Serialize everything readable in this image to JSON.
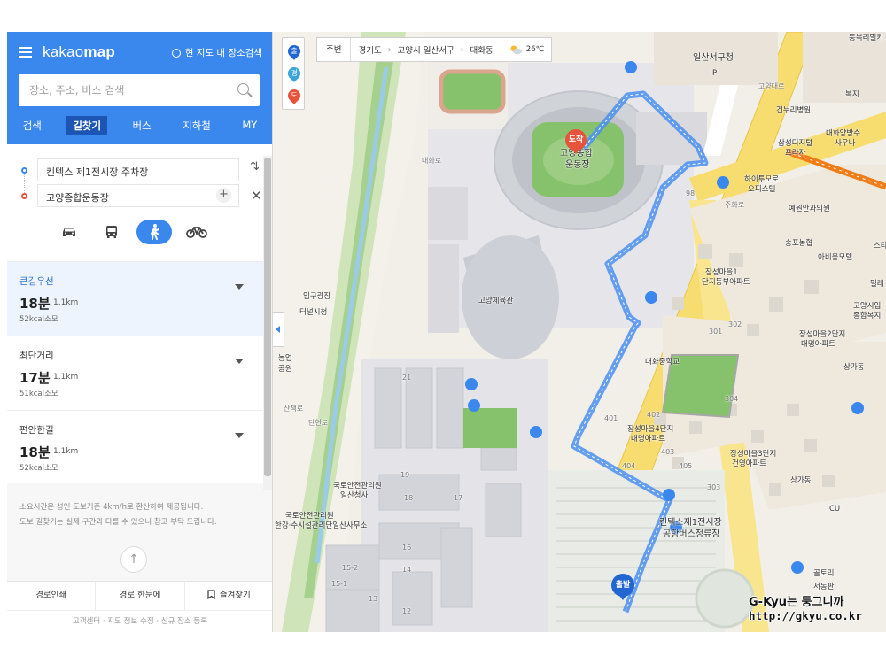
{
  "panel": {
    "logo_light": "kakao",
    "logo_bold": "map",
    "map_search_label": "현 지도 내 장소검색",
    "search_placeholder": "장소, 주소, 버스 검색",
    "tabs": [
      "검색",
      "길찾기",
      "버스",
      "지하철",
      "MY"
    ],
    "active_tab": "길찾기",
    "origin": "킨텍스 제1전시장 주차장",
    "destination": "고양종합운동장",
    "modes": [
      "car-icon",
      "bus-icon",
      "walk-icon",
      "bike-icon"
    ],
    "active_mode": "walk-icon",
    "routes": [
      {
        "name": "큰길우선",
        "time": "18분",
        "distance": "1.1km",
        "calories": "52kcal소모"
      },
      {
        "name": "최단거리",
        "time": "17분",
        "distance": "1.1km",
        "calories": "51kcal소모"
      },
      {
        "name": "편안한길",
        "time": "18분",
        "distance": "1.1km",
        "calories": "52kcal소모"
      }
    ],
    "note1": "소요시간은 성인 도보기준 4km/h로 환산하여 제공됩니다.",
    "note2": "도보 길찾기는 실제 구간과 다를 수 있으니 참고 부탁 드립니다.",
    "actions": [
      "경로인쇄",
      "경로 한눈에",
      "즐겨찾기"
    ],
    "footer": [
      "고객센터",
      "지도 정보 수정",
      "신규 장소 등록"
    ]
  },
  "map": {
    "nearby_button": "주변",
    "marker_labels": [
      "출",
      "경",
      "도"
    ],
    "breadcrumbs": [
      "경기도",
      "고양시 일산서구",
      "대화동"
    ],
    "temperature": "26℃",
    "start_label": "출발",
    "end_label": "도착",
    "places": {
      "city_hall": "일산서구청",
      "hall": "고양체육관",
      "stadium1": "고양종합",
      "stadium2": "운동장",
      "kintex1": "킨텍스제1전시장",
      "kintex2": "공항버스정류장",
      "school": "대화중학교",
      "geonuri": "건누리병원",
      "daehwa1": "대화양방수",
      "daehwa2": "사우나",
      "samsung1": "삼성디지털",
      "samsung2": "프라자",
      "hightop1": "하이투모로",
      "hightop2": "오피스텔",
      "yewon": "예원안과의원",
      "songpo": "송포농협",
      "avimo": "아비응모텔",
      "jangseong1a": "장성마을1",
      "jangseong1b": "단지동부아파트",
      "jangseong2a": "장성마을2단지",
      "jangseong2b": "대명아파트",
      "jangseong4a": "장성마을4단지",
      "jangseong4b": "대명아파트",
      "jangseong3a": "장성마을3단지",
      "jangseong3b": "건영아파트",
      "goyang_ip1": "고양시입",
      "goyang_ip2": "종합복지",
      "molit1": "국토안전관리원",
      "molit2": "일산청사",
      "molit3": "국토안전관리원",
      "molit4": "한강·수시설관리단일산사무소",
      "ipgu1": "입구광장",
      "ipgu2": "터널시청",
      "nonghak1": "농업",
      "nonghak2": "공원",
      "sangga1": "상가동",
      "sangga2": "상가동",
      "golto": "골토리",
      "seodong": "서동판",
      "cu": "CU",
      "bokjip": "복지",
      "bunggeunri": "퉁복리밀키",
      "stgroup": "스타",
      "milre": "밀레",
      "pyo": "P",
      "tanhwa": "탄화로"
    },
    "roads": [
      "고양대로",
      "대화로",
      "주화로",
      "98",
      "산책로",
      "탄현로"
    ],
    "numbers": [
      "21",
      "19",
      "18",
      "17",
      "16",
      "15-2",
      "15-1",
      "14",
      "13",
      "12",
      "401",
      "402",
      "403",
      "404",
      "405",
      "301",
      "302",
      "303",
      "304"
    ]
  },
  "watermark": {
    "line1": "G-Kyu는 둥그니까",
    "line2": "http://gkyu.co.kr"
  },
  "colors": {
    "brand": "#3a87ee",
    "route": "#4a8ff0",
    "start_marker": "#2166d3",
    "end_marker": "#e8533c",
    "subway_line": "#f07d16"
  }
}
